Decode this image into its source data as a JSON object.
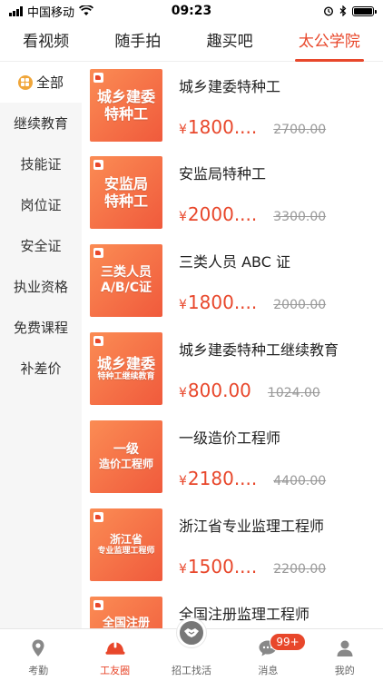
{
  "status": {
    "carrier": "中国移动",
    "time": "09:23"
  },
  "top_tabs": [
    "看视频",
    "随手拍",
    "趣买吧",
    "太公学院"
  ],
  "sidebar": {
    "items": [
      "全部",
      "继续教育",
      "技能证",
      "岗位证",
      "安全证",
      "执业资格",
      "免费课程",
      "补差价"
    ]
  },
  "courses": [
    {
      "thumb_line1": "城乡建委",
      "thumb_line2": "特种工",
      "title": "城乡建委特种工",
      "price": "1800....",
      "old_price": "2700.00"
    },
    {
      "thumb_line1": "安监局",
      "thumb_line2": "特种工",
      "title": "安监局特种工",
      "price": "2000....",
      "old_price": "3300.00"
    },
    {
      "thumb_line1": "三类人员",
      "thumb_line2": "A/B/C证",
      "title": "三类人员 ABC 证",
      "price": "1800....",
      "old_price": "2000.00"
    },
    {
      "thumb_line1": "城乡建委",
      "thumb_line2": "特种工继续教育",
      "title": "城乡建委特种工继续教育",
      "price": "800.00",
      "old_price": "1024.00"
    },
    {
      "thumb_line1": "一级",
      "thumb_line2": "造价工程师",
      "title": "一级造价工程师",
      "price": "2180....",
      "old_price": "4400.00"
    },
    {
      "thumb_line1": "浙江省",
      "thumb_line2": "专业监理工程师",
      "title": "浙江省专业监理工程师",
      "price": "1500....",
      "old_price": "2200.00"
    },
    {
      "thumb_line1": "全国注册",
      "thumb_line2": "",
      "title": "全国注册监理工程师",
      "price": "",
      "old_price": ""
    }
  ],
  "currency": "¥",
  "bottom_nav": [
    {
      "label": "考勤",
      "icon": "location-pin-icon"
    },
    {
      "label": "工友圈",
      "icon": "hard-hat-icon"
    },
    {
      "label": "招工找活",
      "icon": "handshake-icon"
    },
    {
      "label": "消息",
      "icon": "chat-bubble-icon",
      "badge": "99+"
    },
    {
      "label": "我的",
      "icon": "user-icon"
    }
  ],
  "colors": {
    "accent": "#e8472b",
    "thumb_from": "#fb8c54",
    "thumb_to": "#f05a3c"
  }
}
